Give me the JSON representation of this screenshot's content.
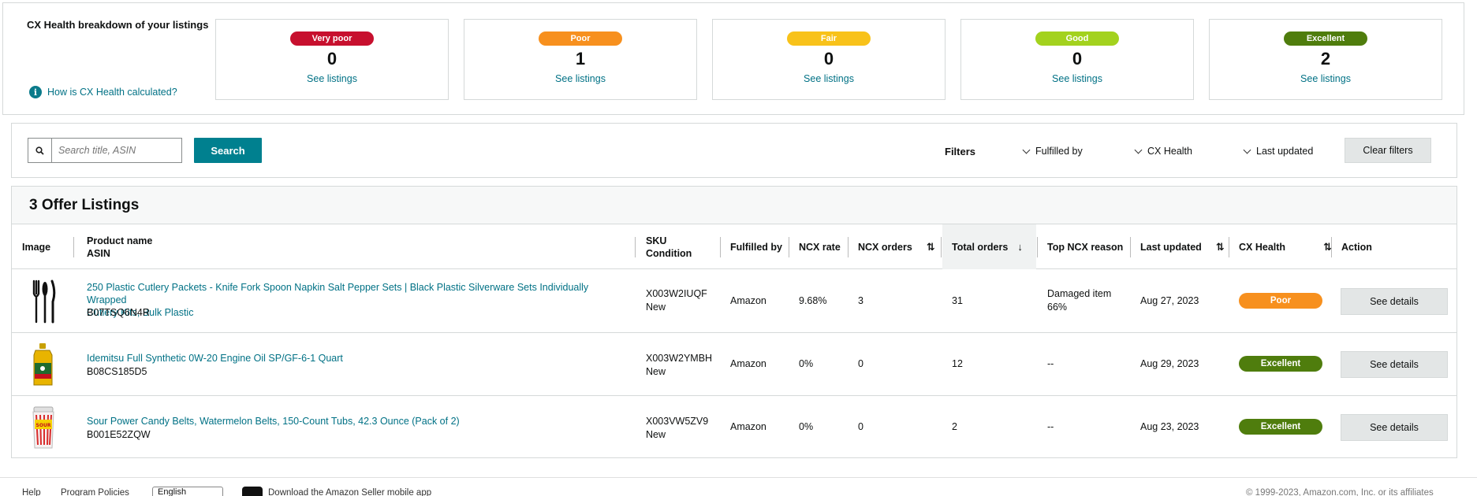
{
  "cx_health": {
    "title": "CX Health breakdown of your listings",
    "how_link": "How is CX Health calculated?",
    "cards": [
      {
        "label": "Very poor",
        "count": "0",
        "link": "See listings",
        "color": "#c7102e"
      },
      {
        "label": "Poor",
        "count": "1",
        "link": "See listings",
        "color": "#f7901e"
      },
      {
        "label": "Fair",
        "count": "0",
        "link": "See listings",
        "color": "#f8c21a"
      },
      {
        "label": "Good",
        "count": "0",
        "link": "See listings",
        "color": "#a3d21e"
      },
      {
        "label": "Excellent",
        "count": "2",
        "link": "See listings",
        "color": "#4f7d0d"
      }
    ]
  },
  "search": {
    "placeholder": "Search title, ASIN",
    "button": "Search"
  },
  "filters": {
    "label": "Filters",
    "dropdowns": [
      "Fulfilled by",
      "CX Health",
      "Last updated"
    ],
    "clear": "Clear filters"
  },
  "listings": {
    "title": "3 Offer Listings",
    "columns": {
      "image": "Image",
      "product_name": "Product name",
      "asin": "ASIN",
      "sku": "SKU",
      "condition": "Condition",
      "fulfilled_by": "Fulfilled by",
      "ncx_rate": "NCX rate",
      "ncx_orders": "NCX orders",
      "total_orders": "Total orders",
      "top_reason": "Top NCX reason",
      "last_updated": "Last updated",
      "cx_health": "CX Health",
      "action": "Action"
    },
    "rows": [
      {
        "product_line1": "250 Plastic Cutlery Packets - Knife Fork Spoon Napkin Salt Pepper Sets | Black Plastic Silverware Sets Individually Wrapped",
        "product_line2": "Cutlery Kits, Bulk Plastic",
        "asin": "B07TSQ6N4R",
        "sku": "X003W2IUQF",
        "condition": "New",
        "fulfilled_by": "Amazon",
        "ncx_rate": "9.68%",
        "ncx_orders": "3",
        "total_orders": "31",
        "top_reason_1": "Damaged item",
        "top_reason_2": "66%",
        "last_updated": "Aug 27, 2023",
        "cx_health": "Poor",
        "cx_color": "#f7901e",
        "action": "See details",
        "image_icon": "cutlery-icon"
      },
      {
        "product_line1": "Idemitsu Full Synthetic 0W-20 Engine Oil SP/GF-6-1 Quart",
        "product_line2": "",
        "asin": "B08CS185D5",
        "sku": "X003W2YMBH",
        "condition": "New",
        "fulfilled_by": "Amazon",
        "ncx_rate": "0%",
        "ncx_orders": "0",
        "total_orders": "12",
        "top_reason_1": "--",
        "top_reason_2": "",
        "last_updated": "Aug 29, 2023",
        "cx_health": "Excellent",
        "cx_color": "#4f7d0d",
        "action": "See details",
        "image_icon": "oil-bottle-icon"
      },
      {
        "product_line1": "Sour Power Candy Belts, Watermelon Belts, 150-Count Tubs, 42.3 Ounce (Pack of 2)",
        "product_line2": "",
        "asin": "B001E52ZQW",
        "sku": "X003VW5ZV9",
        "condition": "New",
        "fulfilled_by": "Amazon",
        "ncx_rate": "0%",
        "ncx_orders": "0",
        "total_orders": "2",
        "top_reason_1": "--",
        "top_reason_2": "",
        "last_updated": "Aug 23, 2023",
        "cx_health": "Excellent",
        "cx_color": "#4f7d0d",
        "action": "See details",
        "image_icon": "candy-tub-icon"
      }
    ]
  },
  "footer": {
    "help": "Help",
    "policies": "Program Policies",
    "language": "English",
    "app": "Download the Amazon Seller mobile app",
    "copyright": "© 1999-2023, Amazon.com, Inc. or its affiliates"
  }
}
